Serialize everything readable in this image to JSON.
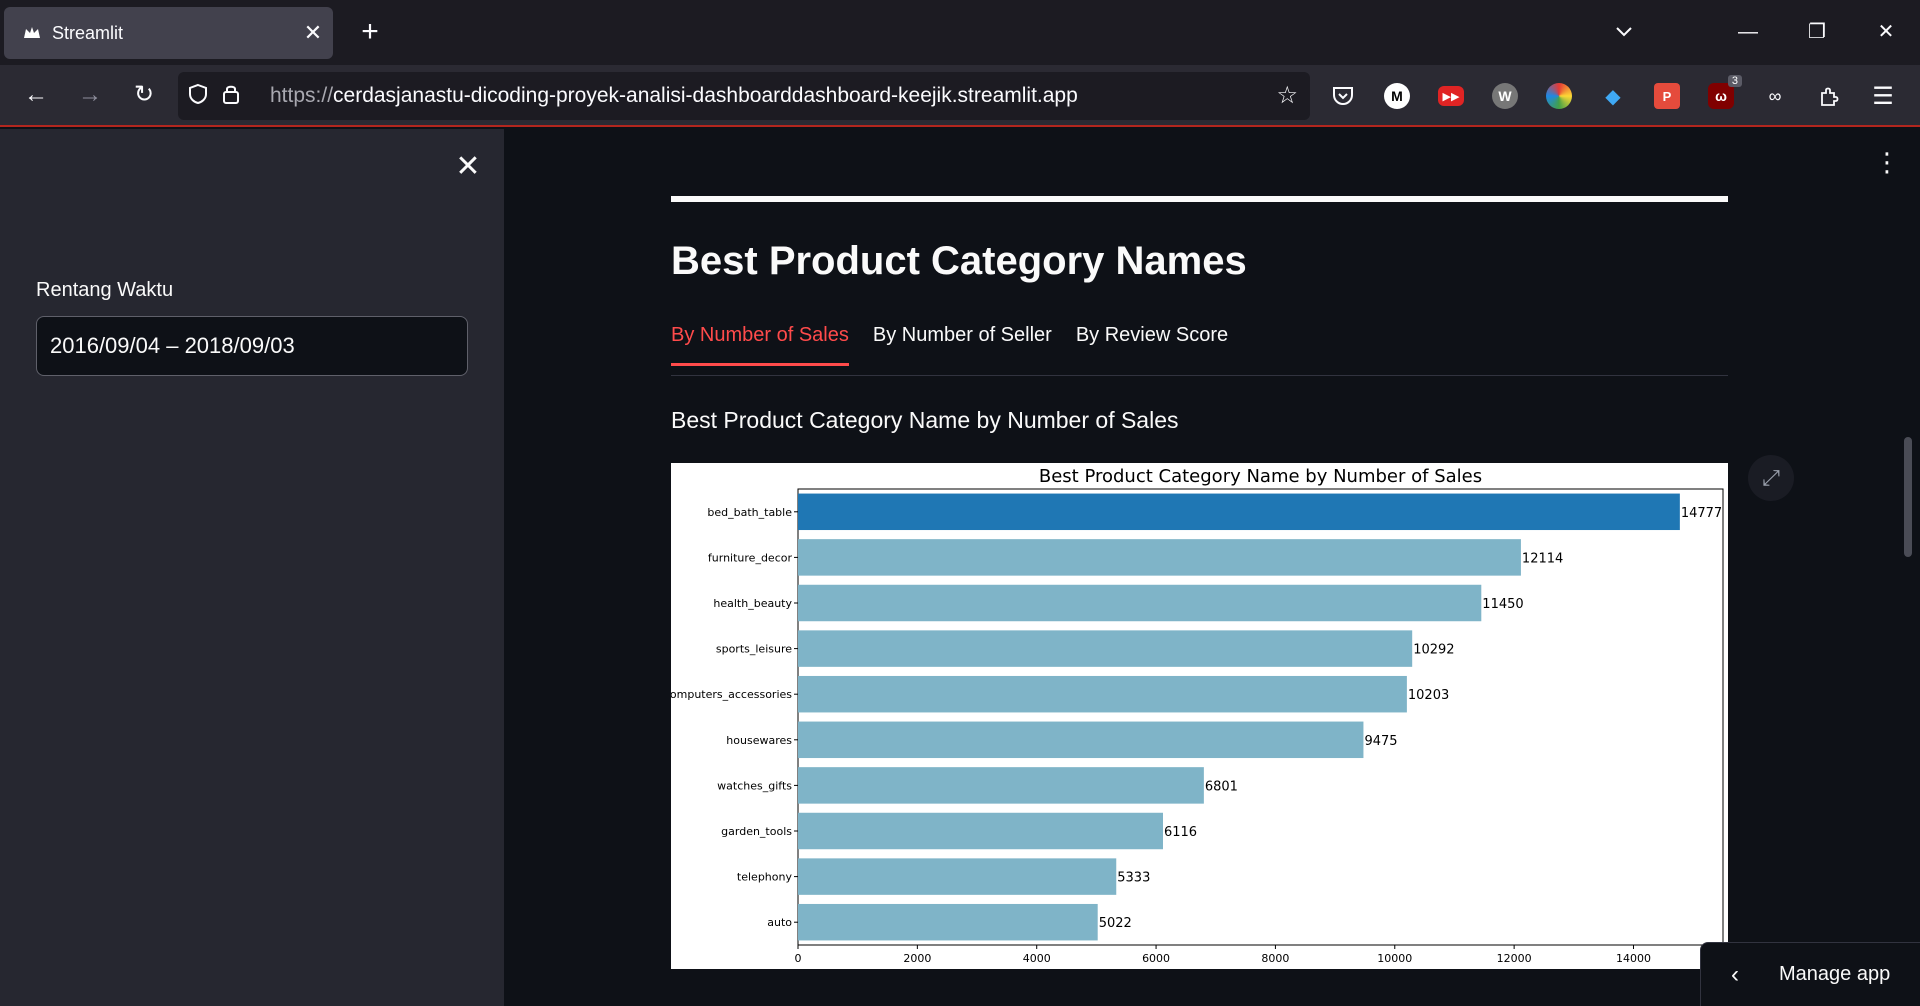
{
  "browser": {
    "tab_title": "Streamlit",
    "url_protocol": "https://",
    "url_rest": "cerdasjanastu-dicoding-proyek-analisi-dashboarddashboard-keejik.streamlit.app",
    "extension_badge": "3"
  },
  "sidebar": {
    "date_label": "Rentang Waktu",
    "date_value": "2016/09/04 – 2018/09/03"
  },
  "main": {
    "section_title": "Best Product Category Names",
    "tabs": [
      {
        "label": "By Number of Sales",
        "active": true
      },
      {
        "label": "By Number of Seller",
        "active": false
      },
      {
        "label": "By Review Score",
        "active": false
      }
    ],
    "subheader": "Best Product Category Name by Number of Sales",
    "manage_app": "Manage app"
  },
  "chart_data": {
    "type": "bar",
    "orientation": "horizontal",
    "title": "Best Product Category Name by Number of Sales",
    "categories": [
      "bed_bath_table",
      "furniture_decor",
      "health_beauty",
      "sports_leisure",
      "computers_accessories",
      "housewares",
      "watches_gifts",
      "garden_tools",
      "telephony",
      "auto"
    ],
    "values": [
      14777,
      12114,
      11450,
      10292,
      10203,
      9475,
      6801,
      6116,
      5333,
      5022
    ],
    "highlight_color": "#1f77b4",
    "bar_color": "#7fb4c8",
    "xlim": [
      0,
      15500
    ],
    "xticks": [
      0,
      2000,
      4000,
      6000,
      8000,
      10000,
      12000,
      14000
    ],
    "xlabel": "",
    "ylabel": ""
  }
}
